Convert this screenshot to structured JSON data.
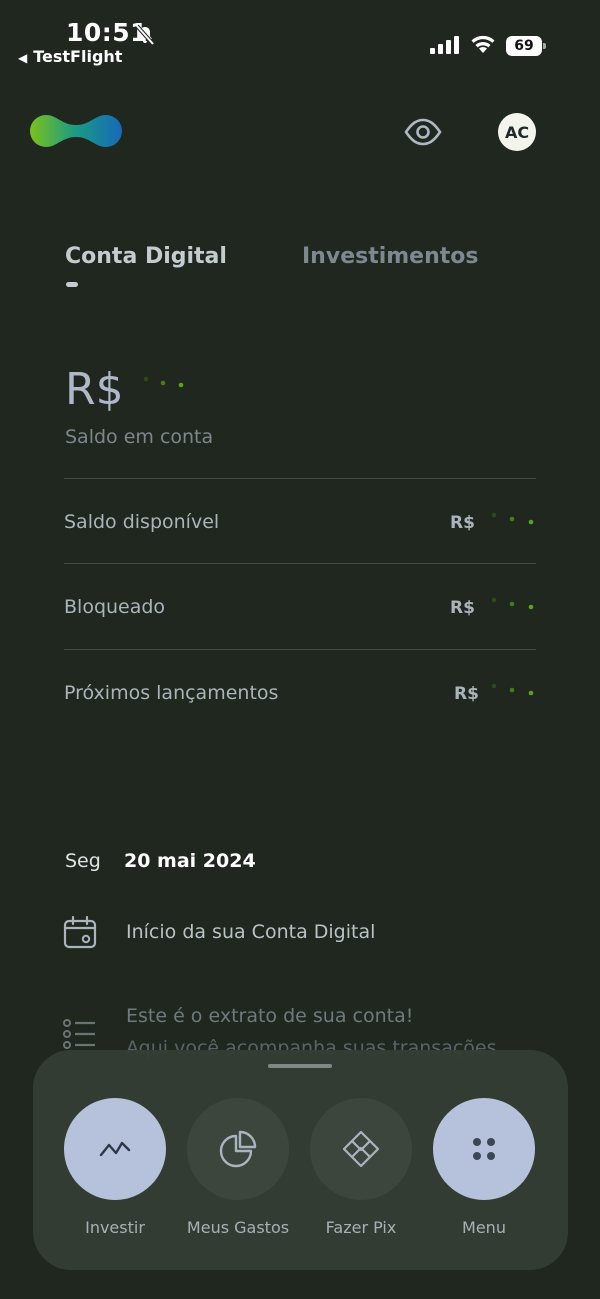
{
  "status_bar": {
    "time": "10:51",
    "back_app": "TestFlight",
    "battery": "69"
  },
  "header": {
    "avatar_initials": "AC",
    "icons": [
      "logo",
      "eye-icon"
    ]
  },
  "tabs": [
    {
      "label": "Conta Digital",
      "active": true
    },
    {
      "label": "Investimentos",
      "active": false
    }
  ],
  "balance": {
    "currency": "R$",
    "label": "Saldo em conta"
  },
  "rows": [
    {
      "label": "Saldo disponível",
      "currency": "R$"
    },
    {
      "label": "Bloqueado",
      "currency": "R$"
    },
    {
      "label": "Próximos lançamentos",
      "currency": "R$"
    }
  ],
  "statement": {
    "weekday": "Seg",
    "date": "20 mai 2024",
    "item_title": "Início da sua Conta Digital",
    "info_line1": "Este é o extrato de sua conta!",
    "info_line2": "Aqui você acompanha suas transações"
  },
  "actions": [
    {
      "label": "Investir",
      "icon": "trend-line-icon"
    },
    {
      "label": "Meus Gastos",
      "icon": "pie-chart-icon"
    },
    {
      "label": "Fazer Pix",
      "icon": "pix-icon"
    },
    {
      "label": "Menu",
      "icon": "menu-dots-icon"
    }
  ],
  "colors": {
    "background": "#1f271f",
    "accent_green": "#5aa418",
    "button_light": "#b6c2dc"
  }
}
